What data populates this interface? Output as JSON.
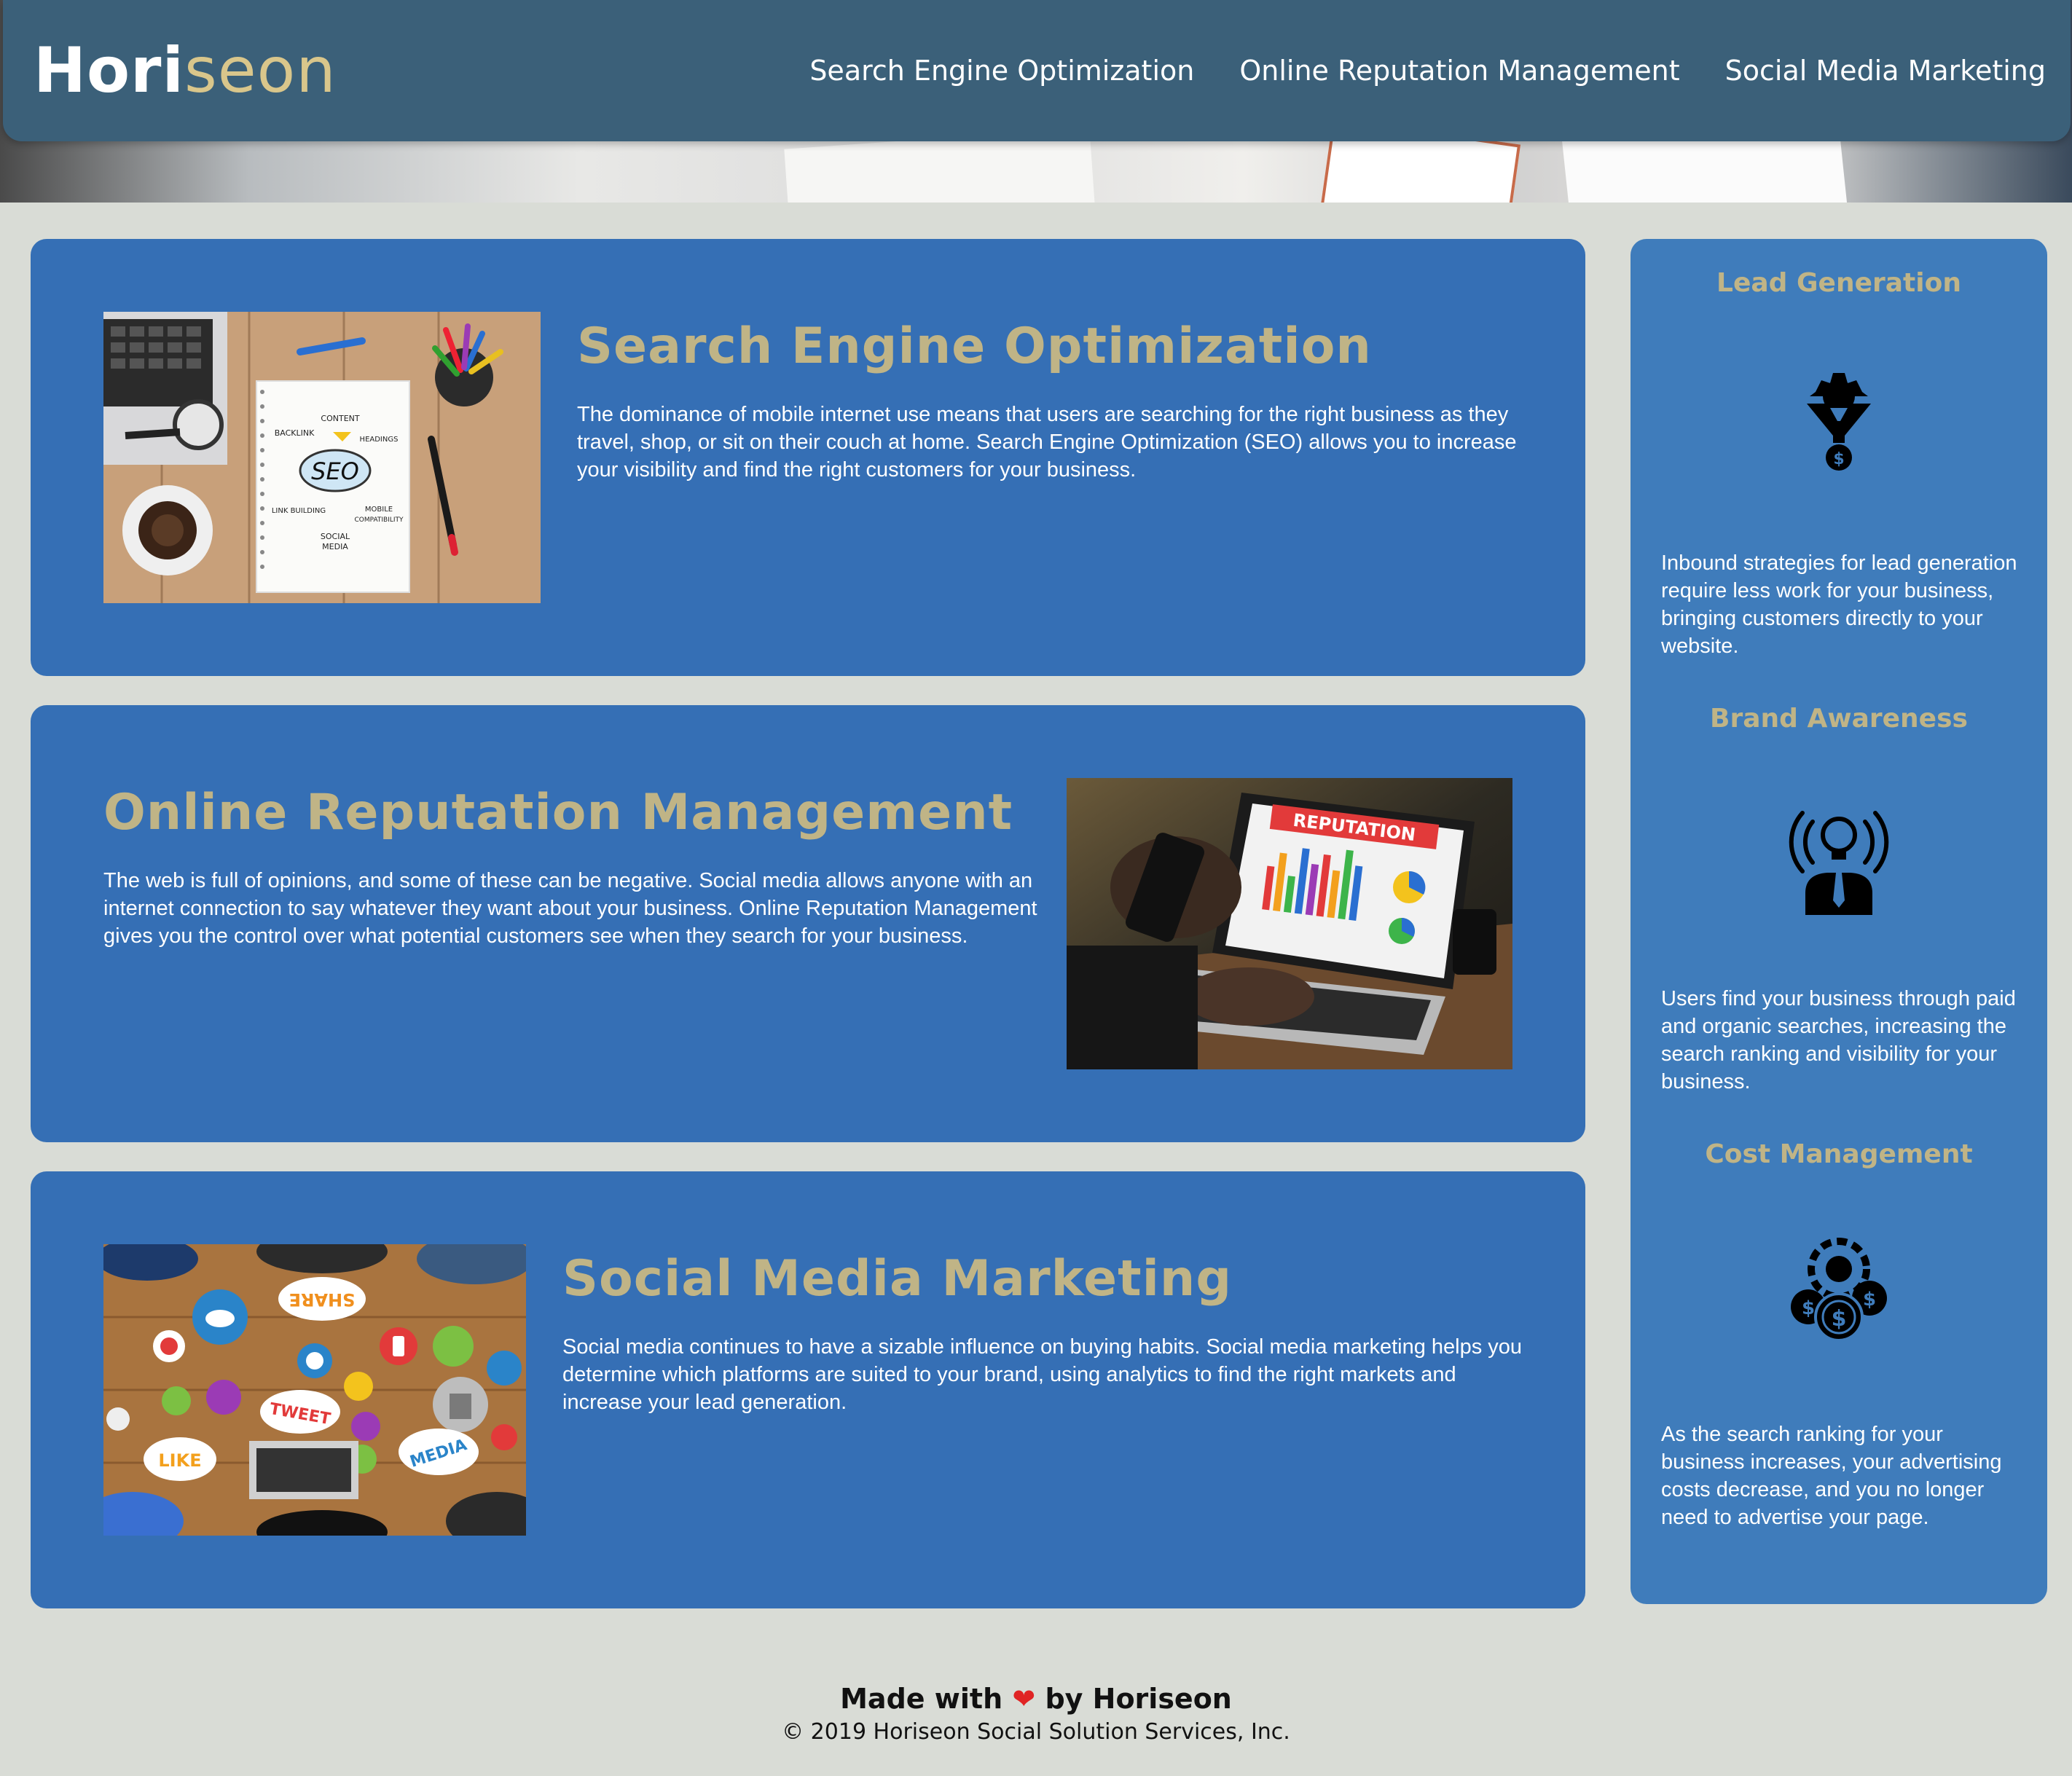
{
  "header": {
    "logo_main": "Hori",
    "logo_accent": "seon",
    "nav": [
      {
        "label": "Search Engine Optimization"
      },
      {
        "label": "Online Reputation Management"
      },
      {
        "label": "Social Media Marketing"
      }
    ]
  },
  "content": {
    "seo": {
      "title": "Search Engine Optimization",
      "text": "The dominance of mobile internet use means that users are searching for the right business as they travel, shop, or sit on their couch at home. Search Engine Optimization (SEO) allows you to increase your visibility and find the right customers for your business.",
      "image_words": {
        "content": "CONTENT",
        "backlink": "BACKLINK",
        "headings": "HEADINGS",
        "seo": "SEO",
        "link_building": "LINK BUILDING",
        "mobile": "MOBILE",
        "compat": "COMPATIBILITY",
        "social": "SOCIAL",
        "media": "MEDIA"
      }
    },
    "orm": {
      "title": "Online Reputation Management",
      "text": "The web is full of opinions, and some of these can be negative. Social media allows anyone with an internet connection to say whatever they want about your business. Online Reputation Management gives you the control over what potential customers see when they search for your business.",
      "image_words": {
        "reputation": "REPUTATION"
      }
    },
    "smm": {
      "title": "Social Media Marketing",
      "text": "Social media continues to have a sizable influence on buying habits. Social media marketing helps you determine which platforms are suited to your brand, using analytics to find the right markets and increase your lead generation.",
      "image_words": {
        "share": "SHARE",
        "tweet": "TWEET",
        "like": "LIKE",
        "media": "MEDIA"
      }
    }
  },
  "benefits": {
    "lead": {
      "title": "Lead Generation",
      "text": "Inbound strategies for lead generation require less work for your business, bringing customers directly to your website.",
      "icon": "lead-funnel-icon"
    },
    "brand": {
      "title": "Brand Awareness",
      "text": "Users find your business through paid and organic searches, increasing the search ranking and visibility for your business.",
      "icon": "brand-lightbulb-icon"
    },
    "cost": {
      "title": "Cost Management",
      "text": "As the search ranking for your business increases, your advertising costs decrease, and you no longer need to advertise your page.",
      "icon": "cost-coins-icon"
    }
  },
  "footer": {
    "made_prefix": "Made with",
    "heart": "❤",
    "made_suffix": "by Horiseon",
    "copyright": "© 2019 Horiseon Social Solution Services, Inc."
  },
  "colors": {
    "header_bg": "#3b6079",
    "card_bg": "#356fb5",
    "aside_bg": "#3f7cbb",
    "accent": "#c0b486",
    "page_bg": "#d9dcd6"
  }
}
